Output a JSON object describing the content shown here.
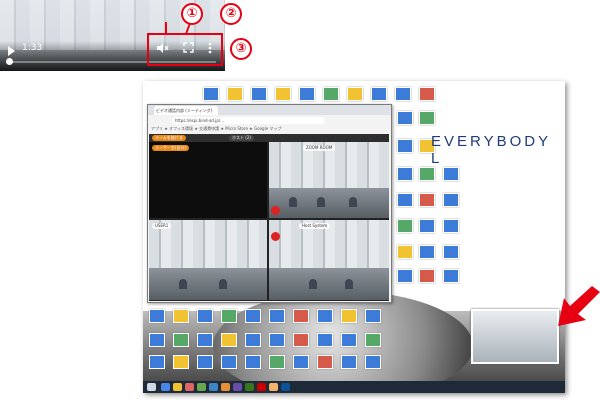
{
  "player": {
    "time": "1:33",
    "callouts": [
      "①",
      "②",
      "③"
    ],
    "progress_fraction": 0.0
  },
  "browser": {
    "tab_title": "ビデオ通話内部 (ミーティング)",
    "url": "https://espi.bind-ad.jp/...",
    "bookmarks": "アプリ  ★  オフィス環境  ★  交通費申請  ★  Micro Store  ★  Google マップ",
    "header_labels": {
      "left": "ルームを抜ける",
      "right": "ホスト (2)"
    },
    "tiles": [
      {
        "label": "ユーザー名(自分)",
        "type": "black"
      },
      {
        "label": "ZOOM ROOM",
        "type": "camera"
      },
      {
        "label": "USER1",
        "type": "camera"
      },
      {
        "label": "Host System",
        "type": "camera"
      }
    ]
  },
  "desktop": {
    "brand_text": "EVERYBODY L"
  },
  "colors": {
    "accent": "#e60012",
    "host_orange": "#e8891a",
    "desktop_brand": "#1f3b7a"
  },
  "icons": {
    "mute": "mute-icon",
    "fullscreen": "fullscreen-icon",
    "menu": "kebab-menu-icon",
    "play": "play-icon"
  }
}
